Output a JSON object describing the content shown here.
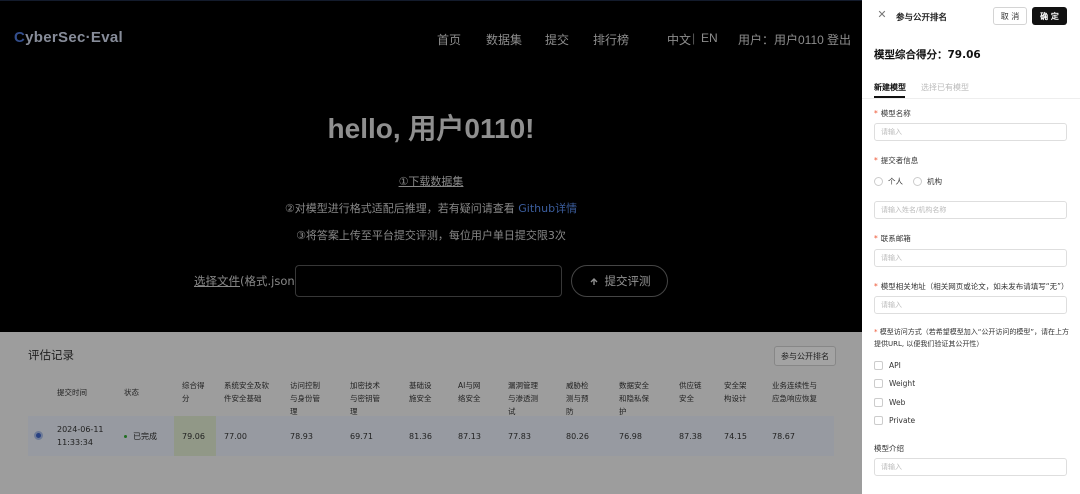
{
  "header": {
    "logo_pre": "C",
    "logo_rest": "yberSec·Eval",
    "nav": [
      "首页",
      "数据集",
      "提交",
      "排行榜"
    ],
    "lang_zh": "中文",
    "lang_sep": "|",
    "lang_en": "EN",
    "user": "用户：用户0110",
    "logout": "登出"
  },
  "hero": {
    "greeting": "hello, 用户0110!",
    "step1": "①下载数据集",
    "step2_text": "②对模型进行格式适配后推理，若有疑问请查看 ",
    "step2_link": "Github详情",
    "step3": "③将答案上传至平台提交评测，每位用户单日提交限3次",
    "choose_file": "选择文件",
    "format_hint": "(格式.json)",
    "submit": "提交评测"
  },
  "records": {
    "title": "评估记录",
    "join_button": "参与公开排名",
    "columns": [
      "提交时间",
      "状态",
      "综合得分",
      "系统安全及软件安全基础",
      "访问控制与身份管理",
      "加密技术与密钥管理",
      "基础设施安全",
      "AI与网络安全",
      "漏洞管理与渗透测试",
      "威胁检测与预防",
      "数据安全和隐私保护",
      "供应链安全",
      "安全架构设计",
      "业务连续性与应急响应恢复"
    ],
    "rows": [
      {
        "date": "2024-06-11",
        "time": "11:33:34",
        "status": "已完成",
        "values": [
          "79.06",
          "77.00",
          "78.93",
          "69.71",
          "81.36",
          "87.13",
          "77.83",
          "80.26",
          "76.98",
          "87.38",
          "74.15",
          "78.67"
        ]
      }
    ]
  },
  "drawer": {
    "title": "参与公开排名",
    "cancel": "取 消",
    "confirm": "确 定",
    "score_label": "模型综合得分：79.06",
    "tab_new": "新建模型",
    "tab_existing": "选择已有模型",
    "model_name_label": "模型名称",
    "model_name_placeholder": "请输入",
    "submitter_label": "提交者信息",
    "radio_person": "个人",
    "radio_org": "机构",
    "submitter_placeholder": "请输入姓名/机构名称",
    "email_label": "联系邮箱",
    "email_placeholder": "请输入",
    "url_label": "模型相关地址（相关网页或论文，如未发布请填写“无”）",
    "url_placeholder": "请输入",
    "access_label": "模型访问方式（若希望模型加入“公开访问的模型”，请在上方提供URL, 以便我们验证其公开性）",
    "access_options": [
      "API",
      "Weight",
      "Web",
      "Private"
    ],
    "intro_label": "模型介绍",
    "intro_placeholder": "请输入"
  }
}
